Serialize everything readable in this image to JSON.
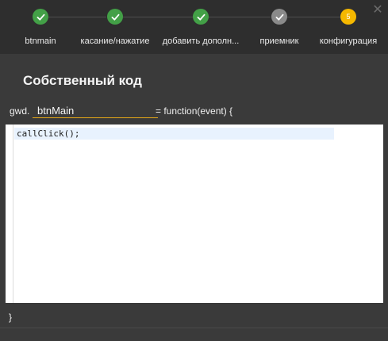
{
  "stepper": {
    "steps": [
      {
        "label": "btnmain",
        "state": "done",
        "icon": "check-icon"
      },
      {
        "label": "касание/нажатие",
        "state": "done",
        "icon": "check-icon"
      },
      {
        "label": "добавить дополн...",
        "state": "done",
        "icon": "check-icon"
      },
      {
        "label": "приемник",
        "state": "done-inactive",
        "icon": "check-icon"
      },
      {
        "label": "конфигурация",
        "state": "current",
        "number": "5"
      }
    ],
    "close_icon": "close-icon"
  },
  "dialog": {
    "title": "Собственный код",
    "signature_prefix": "gwd.",
    "function_name": "btnMain",
    "signature_suffix": "= function(event) {",
    "code": "callClick();",
    "closing_brace": "}"
  },
  "colors": {
    "done": "#43a047",
    "inactive": "#8a8a8a",
    "current": "#f5b800",
    "input_underline": "#e6a817"
  }
}
